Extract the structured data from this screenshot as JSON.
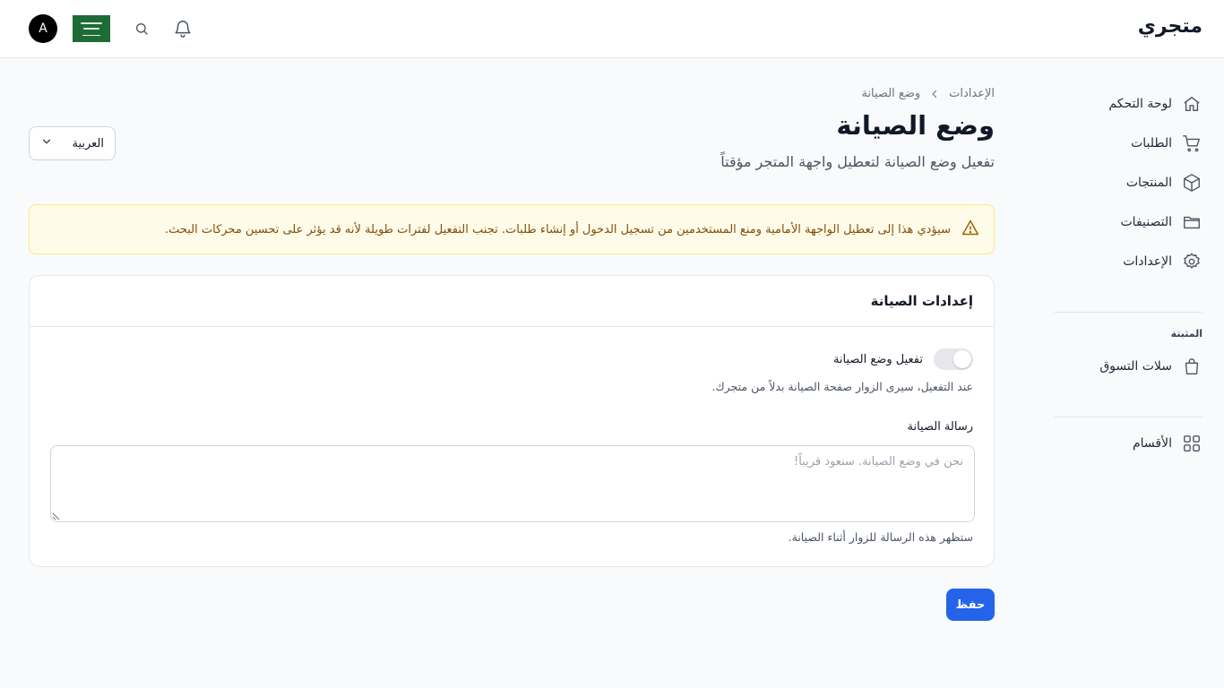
{
  "header": {
    "brand": "متجري",
    "avatar_initial": "A",
    "flag_icon": "saudi-flag-icon",
    "search_icon": "search-icon",
    "notifications_icon": "bell-icon"
  },
  "sidebar": {
    "items": [
      {
        "label": "لوحة التحكم",
        "icon": "home-icon"
      },
      {
        "label": "الطلبات",
        "icon": "cart-icon"
      },
      {
        "label": "المنتجات",
        "icon": "box-icon"
      },
      {
        "label": "التصنيفات",
        "icon": "folder-icon"
      },
      {
        "label": "الإعدادات",
        "icon": "gear-icon"
      }
    ],
    "pinned_section": "المثبتة",
    "pinned_items": [
      {
        "label": "سلات التسوق",
        "icon": "shopping-bag-icon"
      }
    ],
    "extra_items": [
      {
        "label": "الأقسام",
        "icon": "grid-icon"
      }
    ]
  },
  "breadcrumb": {
    "parent": "الإعدادات",
    "current": "وضع الصيانة"
  },
  "page": {
    "title": "وضع الصيانة",
    "subtitle": "تفعيل وضع الصيانة لتعطيل واجهة المتجر مؤقتاً"
  },
  "language_select": {
    "value": "العربية"
  },
  "alert": {
    "text": "سيؤدي هذا إلى تعطيل الواجهة الأمامية ومنع المستخدمين من تسجيل الدخول أو إنشاء طلبات. تجنب التفعيل لفترات طويلة لأنه قد يؤثر على تحسين محركات البحث.",
    "color": "#854d0e"
  },
  "card": {
    "title": "إعدادات الصيانة",
    "toggle_label": "تفعيل وضع الصيانة",
    "toggle_enabled": false,
    "toggle_help": "عند التفعيل، سيرى الزوار صفحة الصيانة بدلاً من متجرك.",
    "message_label": "رسالة الصيانة",
    "message_placeholder": "نحن في وضع الصيانة. سنعود قريباً!",
    "message_help": "ستظهر هذه الرسالة للزوار أثناء الصيانة."
  },
  "actions": {
    "save_label": "حفظ",
    "accent_color": "#2563eb"
  }
}
